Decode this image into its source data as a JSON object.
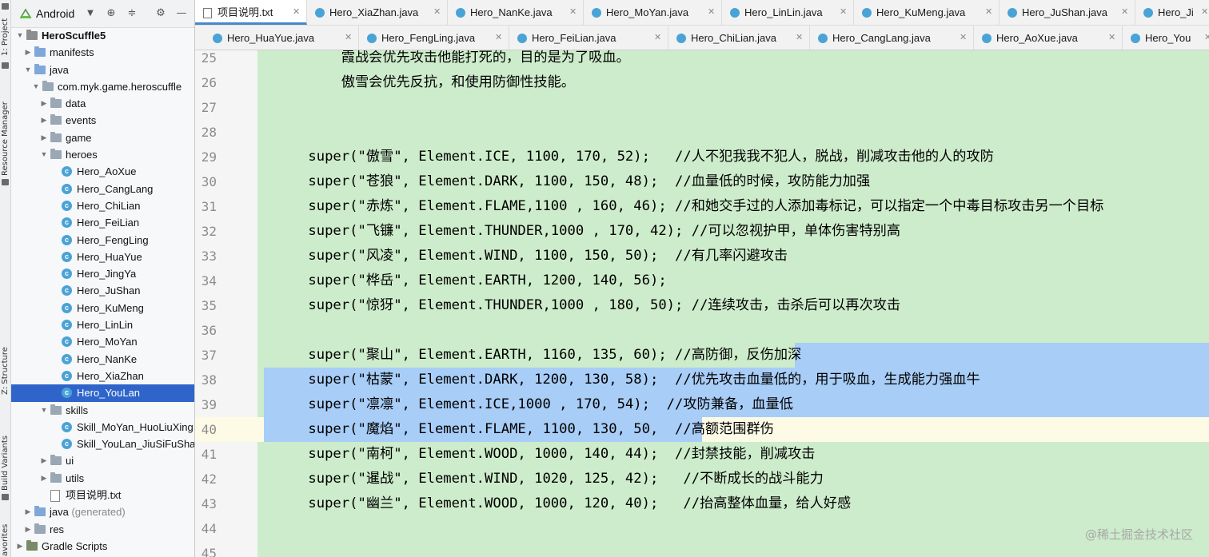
{
  "left_strip": {
    "project_label": "1: Project",
    "resource_manager_label": "Resource Manager",
    "structure_label": "Z: Structure",
    "build_variants_label": "Build Variants",
    "favorites_label": "avorites"
  },
  "project_panel": {
    "view_mode": "Android",
    "header_icons": [
      "target-icon",
      "collapse-icon",
      "gear-icon",
      "minimize-icon"
    ]
  },
  "tree": [
    {
      "label": "HeroScuffle5",
      "depth": 0,
      "kind": "module",
      "expanded": true,
      "bold": true
    },
    {
      "label": "manifests",
      "depth": 1,
      "kind": "folder-blue",
      "expanded": false
    },
    {
      "label": "java",
      "depth": 1,
      "kind": "folder-blue",
      "expanded": true
    },
    {
      "label": "com.myk.game.heroscuffle",
      "depth": 2,
      "kind": "folder",
      "expanded": true
    },
    {
      "label": "data",
      "depth": 3,
      "kind": "folder",
      "expanded": false
    },
    {
      "label": "events",
      "depth": 3,
      "kind": "folder",
      "expanded": false
    },
    {
      "label": "game",
      "depth": 3,
      "kind": "folder",
      "expanded": false
    },
    {
      "label": "heroes",
      "depth": 3,
      "kind": "folder",
      "expanded": true
    },
    {
      "label": "Hero_AoXue",
      "depth": 4,
      "kind": "class"
    },
    {
      "label": "Hero_CangLang",
      "depth": 4,
      "kind": "class"
    },
    {
      "label": "Hero_ChiLian",
      "depth": 4,
      "kind": "class"
    },
    {
      "label": "Hero_FeiLian",
      "depth": 4,
      "kind": "class"
    },
    {
      "label": "Hero_FengLing",
      "depth": 4,
      "kind": "class"
    },
    {
      "label": "Hero_HuaYue",
      "depth": 4,
      "kind": "class"
    },
    {
      "label": "Hero_JingYa",
      "depth": 4,
      "kind": "class"
    },
    {
      "label": "Hero_JuShan",
      "depth": 4,
      "kind": "class"
    },
    {
      "label": "Hero_KuMeng",
      "depth": 4,
      "kind": "class"
    },
    {
      "label": "Hero_LinLin",
      "depth": 4,
      "kind": "class"
    },
    {
      "label": "Hero_MoYan",
      "depth": 4,
      "kind": "class"
    },
    {
      "label": "Hero_NanKe",
      "depth": 4,
      "kind": "class"
    },
    {
      "label": "Hero_XiaZhan",
      "depth": 4,
      "kind": "class"
    },
    {
      "label": "Hero_YouLan",
      "depth": 4,
      "kind": "class",
      "selected": true
    },
    {
      "label": "skills",
      "depth": 3,
      "kind": "folder",
      "expanded": true
    },
    {
      "label": "Skill_MoYan_HuoLiuXing",
      "depth": 4,
      "kind": "class"
    },
    {
      "label": "Skill_YouLan_JiuSiFuShang",
      "depth": 4,
      "kind": "class"
    },
    {
      "label": "ui",
      "depth": 3,
      "kind": "folder",
      "expanded": false
    },
    {
      "label": "utils",
      "depth": 3,
      "kind": "folder",
      "expanded": false
    },
    {
      "label": "项目说明.txt",
      "depth": 3,
      "kind": "txt"
    },
    {
      "label": "java",
      "suffix": " (generated)",
      "depth": 1,
      "kind": "folder-blue",
      "expanded": false
    },
    {
      "label": "res",
      "depth": 1,
      "kind": "folder",
      "expanded": false
    },
    {
      "label": "Gradle Scripts",
      "depth": 0,
      "kind": "gradle",
      "expanded": false
    }
  ],
  "tabs_row1": [
    {
      "label": "项目说明.txt",
      "kind": "file",
      "active": true
    },
    {
      "label": "Hero_XiaZhan.java",
      "kind": "class"
    },
    {
      "label": "Hero_NanKe.java",
      "kind": "class"
    },
    {
      "label": "Hero_MoYan.java",
      "kind": "class"
    },
    {
      "label": "Hero_LinLin.java",
      "kind": "class"
    },
    {
      "label": "Hero_KuMeng.java",
      "kind": "class"
    },
    {
      "label": "Hero_JuShan.java",
      "kind": "class"
    },
    {
      "label": "Hero_Ji",
      "kind": "class"
    }
  ],
  "tabs_row2": [
    {
      "label": "Hero_HuaYue.java",
      "kind": "class"
    },
    {
      "label": "Hero_FengLing.java",
      "kind": "class"
    },
    {
      "label": "Hero_FeiLian.java",
      "kind": "class"
    },
    {
      "label": "Hero_ChiLian.java",
      "kind": "class"
    },
    {
      "label": "Hero_CangLang.java",
      "kind": "class"
    },
    {
      "label": "Hero_AoXue.java",
      "kind": "class"
    },
    {
      "label": "Hero_You",
      "kind": "class"
    }
  ],
  "editor": {
    "current_line": 40,
    "lines": [
      {
        "n": "25",
        "text": "        霞战会优先攻击他能打死的，目的是为了吸血。"
      },
      {
        "n": "26",
        "text": "        傲雪会优先反抗，和使用防御性技能。"
      },
      {
        "n": "27",
        "text": ""
      },
      {
        "n": "28",
        "text": ""
      },
      {
        "n": "29",
        "text": "    super(\"傲雪\", Element.ICE, 1100, 170, 52);   //人不犯我我不犯人，脱战，削减攻击他的人的攻防"
      },
      {
        "n": "30",
        "text": "    super(\"苍狼\", Element.DARK, 1100, 150, 48);  //血量低的时候，攻防能力加强"
      },
      {
        "n": "31",
        "text": "    super(\"赤炼\", Element.FLAME,1100 , 160, 46); //和她交手过的人添加毒标记，可以指定一个中毒目标攻击另一个目标"
      },
      {
        "n": "32",
        "text": "    super(\"飞镰\", Element.THUNDER,1000 , 170, 42); //可以忽视护甲，单体伤害特别高"
      },
      {
        "n": "33",
        "text": "    super(\"风凌\", Element.WIND, 1100, 150, 50);  //有几率闪避攻击"
      },
      {
        "n": "34",
        "text": "    super(\"桦岳\", Element.EARTH, 1200, 140, 56);"
      },
      {
        "n": "35",
        "text": "    super(\"惊犽\", Element.THUNDER,1000 , 180, 50); //连续攻击，击杀后可以再次攻击"
      },
      {
        "n": "36",
        "text": ""
      },
      {
        "n": "37",
        "text": "    super(\"聚山\", Element.EARTH, 1160, 135, 60); //高防御，反伤加深"
      },
      {
        "n": "38",
        "text": "    super(\"枯蒙\", Element.DARK, 1200, 130, 58);  //优先攻击血量低的，用于吸血，生成能力强血牛"
      },
      {
        "n": "39",
        "text": "    super(\"凛凛\", Element.ICE,1000 , 170, 54);  //攻防兼备，血量低"
      },
      {
        "n": "40",
        "text": "    super(\"魔焰\", Element.FLAME, 1100, 130, 50,  //高额范围群伤"
      },
      {
        "n": "41",
        "text": "    super(\"南柯\", Element.WOOD, 1000, 140, 44);  //封禁技能，削减攻击"
      },
      {
        "n": "42",
        "text": "    super(\"暹战\", Element.WIND, 1020, 125, 42);   //不断成长的战斗能力"
      },
      {
        "n": "43",
        "text": "    super(\"幽兰\", Element.WOOD, 1000, 120, 40);   //抬高整体血量，给人好感"
      },
      {
        "n": "44",
        "text": ""
      },
      {
        "n": "45",
        "text": ""
      }
    ]
  },
  "watermark": "@稀土掘金技术社区",
  "colors": {
    "code_bg": "#cdeccb",
    "selection": "#a8cdf7",
    "tree_selected": "#2f65ca",
    "tab_accent": "#4a88c7"
  }
}
